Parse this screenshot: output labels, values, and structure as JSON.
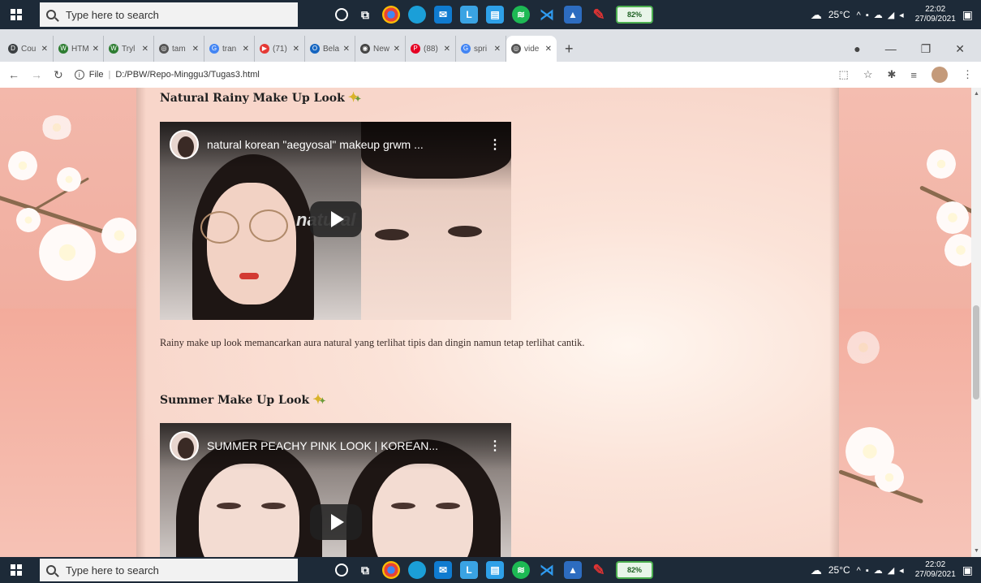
{
  "taskbar": {
    "search_placeholder": "Type here to search",
    "weather": "25°C",
    "time": "22:02",
    "date": "27/09/2021",
    "battery_label": "82%"
  },
  "browser": {
    "tabs": [
      {
        "label": "Cou",
        "color": "#3c4043",
        "glyph": "D"
      },
      {
        "label": "HTM",
        "color": "#2e7d32",
        "glyph": "W"
      },
      {
        "label": "Tryl",
        "color": "#2e7d32",
        "glyph": "W"
      },
      {
        "label": "tam",
        "color": "#555555",
        "glyph": "◎"
      },
      {
        "label": "tran",
        "color": "#4285f4",
        "glyph": "G"
      },
      {
        "label": "(71)",
        "color": "#e53935",
        "glyph": "▶"
      },
      {
        "label": "Bela",
        "color": "#1565c0",
        "glyph": "O"
      },
      {
        "label": "New",
        "color": "#444444",
        "glyph": "◉"
      },
      {
        "label": "(88)",
        "color": "#e60023",
        "glyph": "P"
      },
      {
        "label": "spri",
        "color": "#4285f4",
        "glyph": "G"
      },
      {
        "label": "vide",
        "color": "#555555",
        "glyph": "◎",
        "active": true
      }
    ],
    "url_scheme": "File",
    "url": "D:/PBW/Repo-Minggu3/Tugas3.html"
  },
  "page": {
    "section1": {
      "title": "Natural Rainy Make Up Look",
      "video_title": "natural korean \"aegyosal\" makeup grwm ...",
      "overlay_text": "natural",
      "description": "Rainy make up look memancarkan aura natural yang terlihat tipis dan dingin namun tetap terlihat cantik."
    },
    "section2": {
      "title": "Summer Make Up Look",
      "video_title": "SUMMER PEACHY PINK LOOK | KOREAN..."
    }
  }
}
